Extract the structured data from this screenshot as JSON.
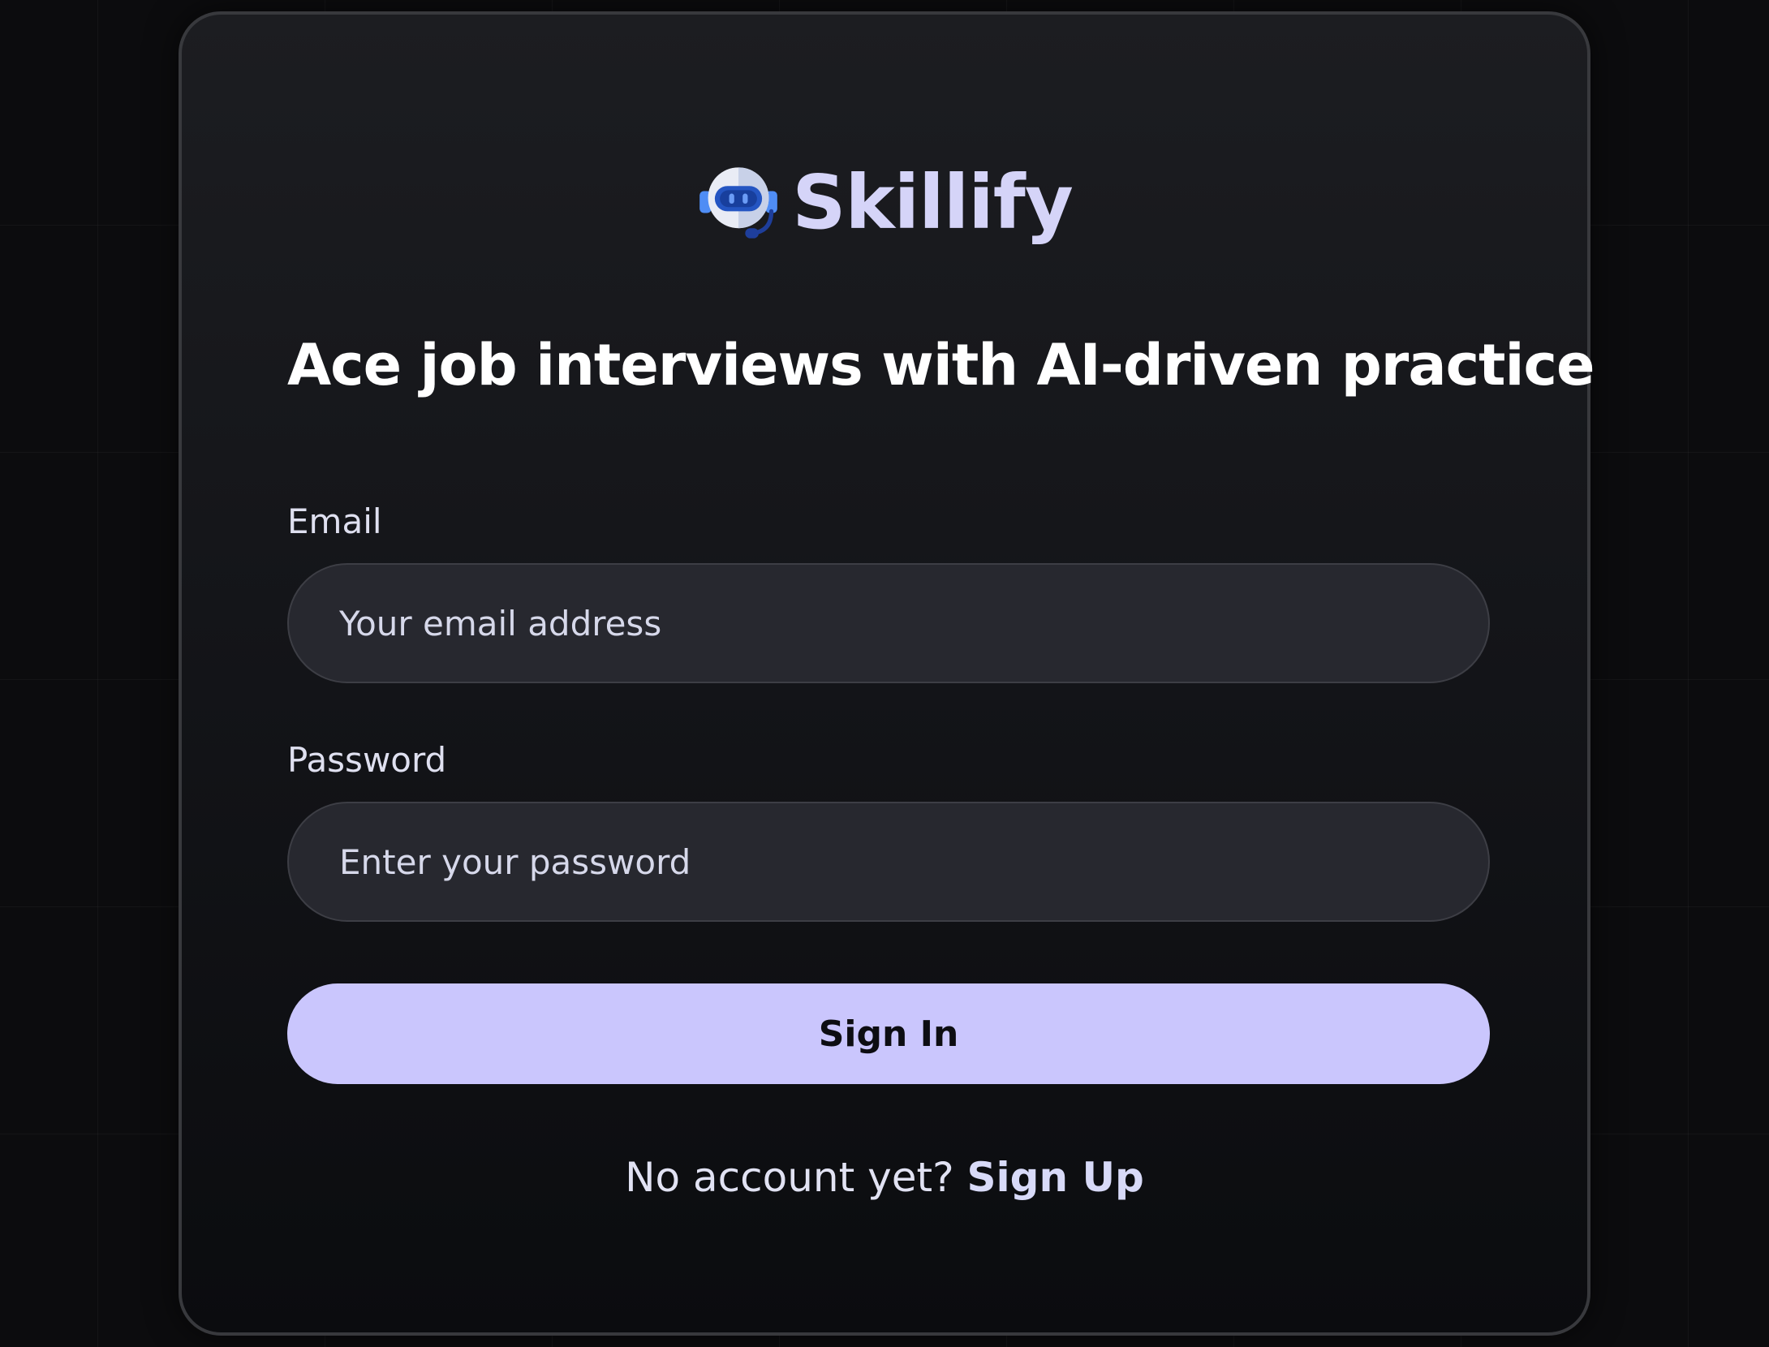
{
  "brand": {
    "name": "Skillify",
    "logo_icon": "robot-headset-icon",
    "name_color": "#d5d4f8"
  },
  "headline": "Ace job interviews with AI-driven practice",
  "form": {
    "email": {
      "label": "Email",
      "placeholder": "Your email address",
      "value": ""
    },
    "password": {
      "label": "Password",
      "placeholder": "Enter your password",
      "value": ""
    },
    "submit_label": "Sign In"
  },
  "footer": {
    "prompt": "No account yet?",
    "signup_label": "Sign Up"
  },
  "colors": {
    "accent": "#cac6fd",
    "card_border": "#38393d",
    "input_bg": "#27282f"
  }
}
